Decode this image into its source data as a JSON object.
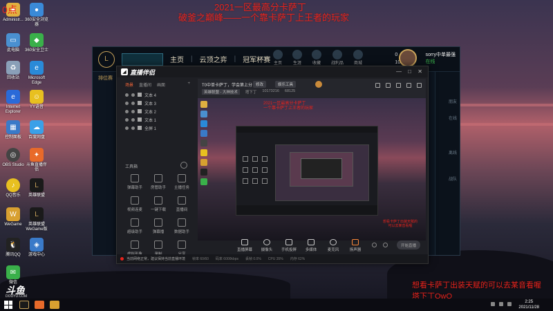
{
  "overlay": {
    "top_line1": "2021一区最高分卡萨丁",
    "top_line2": "破釜之巅峰——一个靠卡萨丁上王者的玩家",
    "bottom_line1": "想看卡萨丁出装天赋的可以去某音看喔",
    "bottom_line2": "塔下丁QwQ",
    "corner": "0点"
  },
  "desktop": {
    "icons": [
      {
        "label": "Administr...",
        "color": "#e0b040"
      },
      {
        "label": "360安全浏览器",
        "color": "#3a8ad8"
      },
      {
        "label": "此电脑",
        "color": "#4a90d0"
      },
      {
        "label": "360安全卫士",
        "color": "#3ab04a"
      },
      {
        "label": "回收站",
        "color": "#8aa0b8"
      },
      {
        "label": "Microsoft Edge",
        "color": "#2a8ad8"
      },
      {
        "label": "Internet Explorer",
        "color": "#2a6ad8"
      },
      {
        "label": "YY语音",
        "color": "#e8c020"
      },
      {
        "label": "控制面板",
        "color": "#3a7ac8"
      },
      {
        "label": "百度网盘",
        "color": "#3aa0e8"
      },
      {
        "label": "OBS Studio",
        "color": "#444"
      },
      {
        "label": "斗鱼直播伴侣",
        "color": "#e86a2a"
      },
      {
        "label": "QQ音乐",
        "color": "#e8c020"
      },
      {
        "label": "英雄联盟",
        "color": "#c9a35a"
      },
      {
        "label": "WeGame",
        "color": "#d8a030"
      },
      {
        "label": "英雄联盟WeGame版",
        "color": "#c9a35a"
      },
      {
        "label": "腾讯QQ",
        "color": "#222"
      },
      {
        "label": "游戏中心",
        "color": "#3a7ac8"
      },
      {
        "label": "微信",
        "color": "#3ab04a"
      }
    ],
    "brand": "斗鱼",
    "brand_url": "DOUYU.COM"
  },
  "lol": {
    "nav": [
      "主页",
      "云顶之弈",
      "冠军杯赛"
    ],
    "icons": [
      "主页",
      "生涯",
      "收藏",
      "战利品",
      "商城"
    ],
    "currency_rp": "0",
    "currency_be": "1055",
    "username": "sorry中单最强",
    "status": "在线",
    "rank_label": "排位赛",
    "side_labels": [
      "朋友",
      "在线",
      "离线",
      "战队"
    ]
  },
  "dz": {
    "app_name": "直播伴侣",
    "left_tabs": [
      "场景",
      "直播间",
      "画面"
    ],
    "scenes": [
      "文本 4",
      "文本 3",
      "文本 2",
      "文本 1",
      "全屏 1"
    ],
    "tools_title": "工具箱",
    "tools": [
      "弹幕助手",
      "房管助手",
      "主播任务",
      "视频连麦",
      "一键下载",
      "直播间",
      "超级助手",
      "弹幕播",
      "数据助手",
      "虚拟形象",
      "录制",
      "分享"
    ],
    "room_title": "T0中单卡萨丁，学会第上分",
    "room_btn1": "修改",
    "room_btn2": "娱乐工具",
    "room_category": "英雄联盟 - 大神技术",
    "room_name": "塔下丁",
    "room_id": "10173216",
    "room_hot": "68125",
    "preview_top": "2021一区最高分卡萨丁\n一个靠卡萨丁上王者的玩家",
    "preview_bottom": "想看卡萨丁出装天赋的\n可以去某音看喔",
    "toolbar": [
      "直播屏幕",
      "摄像头",
      "手机投屏",
      "多媒体",
      "麦克风",
      "扬声器"
    ],
    "live_btn": "开始直播",
    "status_warn": "当前网络正常，建议保持当前直播环境",
    "status_items": [
      "帧率 60/60",
      "码率 6000kbps",
      "丢帧 0.0%",
      "CPU 35%",
      "内存 62%"
    ]
  },
  "taskbar": {
    "time": "2:25",
    "date": "2021/11/28"
  }
}
